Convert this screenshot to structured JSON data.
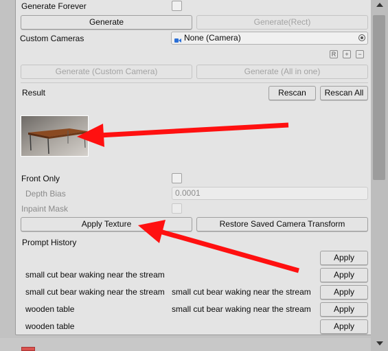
{
  "controls": {
    "generate_forever_label": "Generate Forever",
    "generate_button": "Generate",
    "generate_rect_button": "Generate(Rect)",
    "custom_cameras_label": "Custom Cameras",
    "custom_cameras_value": "None (Camera)",
    "mini_buttons": [
      "R",
      "+",
      "−"
    ],
    "generate_custom_camera_button": "Generate (Custom Camera)",
    "generate_all_button": "Generate (All in one)"
  },
  "result": {
    "label": "Result",
    "rescan_button": "Rescan",
    "rescan_all_button": "Rescan All",
    "thumbnail_icon": "wooden-table-thumbnail"
  },
  "options": {
    "front_only_label": "Front Only",
    "depth_bias_label": "Depth Bias",
    "depth_bias_value": "0.0001",
    "inpaint_mask_label": "Inpaint Mask",
    "apply_texture_button": "Apply Texture",
    "restore_camera_button": "Restore Saved Camera Transform"
  },
  "history": {
    "label": "Prompt History",
    "apply_label": "Apply",
    "rows": [
      {
        "prompt": "",
        "negative": ""
      },
      {
        "prompt": "small cut bear waking near the stream",
        "negative": ""
      },
      {
        "prompt": "small cut bear waking near the stream",
        "negative": "small cut bear waking near the stream"
      },
      {
        "prompt": "wooden table",
        "negative": "small cut bear waking near the stream"
      },
      {
        "prompt": "wooden table",
        "negative": ""
      }
    ]
  },
  "annotation_color": "#ff1010"
}
